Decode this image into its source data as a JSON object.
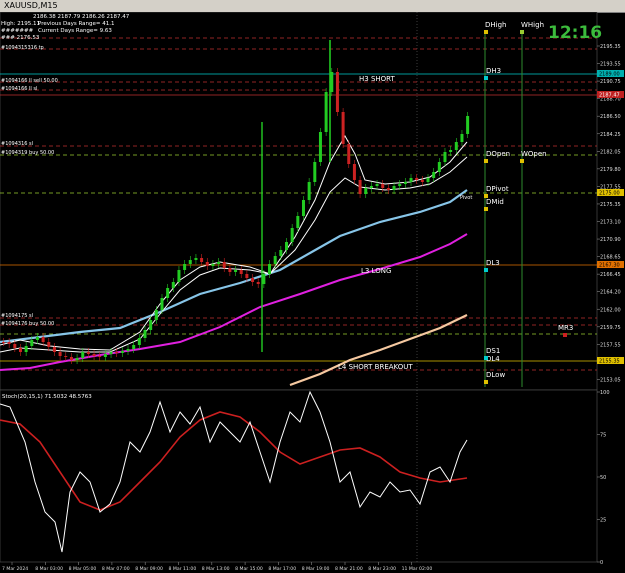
{
  "window": {
    "title": "XAUUSD,M15"
  },
  "info": {
    "ohlc": "2186.38 2187.79 2186.26 2187.47",
    "high_line": "High: 2195.11",
    "prev_range": "Previous Days Range= 41.1",
    "curr_range": "Current Days Range= 9.63",
    "extra1": "#######",
    "extra2": "###  2176.53"
  },
  "clock": {
    "time": "12:16",
    "color": "#3cbb3c"
  },
  "order_labels": {
    "tp": "#1094315316 tp",
    "sell": "#1094166 ll sell 50.00",
    "sell_sl": "#1094166 ll sl",
    "buy_sl": "#1094316 sl",
    "buy": "#1094319 buy 50.00",
    "lower_sl": "#1094175 sl",
    "lower_buy": "#1094176 buy 50.00"
  },
  "levels": {
    "h3_short": "H3 SHORT",
    "l3_long": "L3 LONG",
    "l4_short_breakout": "L4 SHORT BREAKOUT",
    "dhigh": "DHigh",
    "whigh": "WHigh",
    "dh3": "DH3",
    "dopen": "DOpen",
    "wopen": "WOpen",
    "dpivot": "DPivot",
    "dmid": "DMid",
    "dl3": "DL3",
    "mr3": "MR3",
    "ds1": "DS1",
    "dl4": "DL4",
    "dlow": "DLow",
    "pivot": "Pivot"
  },
  "price_axis": {
    "ticks": [
      "2195.35",
      "2193.55",
      "2190.75",
      "2188.70",
      "2186.50",
      "2184.25",
      "2182.05",
      "2179.80",
      "2177.55",
      "2175.35",
      "2173.10",
      "2170.90",
      "2168.65",
      "2166.45",
      "2164.20",
      "2162.00",
      "2159.75",
      "2157.55",
      "2155.30",
      "2153.05"
    ],
    "badges": [
      {
        "text": "2189.00",
        "bg": "#00b0b0",
        "color": "#000"
      },
      {
        "text": "2187.47",
        "bg": "#c02020",
        "color": "#fff"
      },
      {
        "text": "2175.00",
        "bg": "#e0c000",
        "color": "#000"
      },
      {
        "text": "2167.30",
        "bg": "#e07000",
        "color": "#000"
      },
      {
        "text": "2155.35",
        "bg": "#e0c000",
        "color": "#000"
      }
    ]
  },
  "indicator": {
    "label": "Stoch(20,15,1) 71.5032 48.5763",
    "ticks": [
      "100",
      "75",
      "50",
      "25",
      "0"
    ]
  },
  "time_axis": [
    "7 Mar 2024",
    "8 Mar 03:00",
    "8 Mar 05:00",
    "8 Mar 07:00",
    "8 Mar 09:00",
    "8 Mar 11:00",
    "8 Mar 13:00",
    "8 Mar 15:00",
    "8 Mar 17:00",
    "8 Mar 19:00",
    "8 Mar 21:00",
    "8 Mar 23:00",
    "11 Mar 02:00"
  ],
  "colors": {
    "bull": "#22cc22",
    "bear": "#cc2222",
    "ema_fast": "#ffffff",
    "ema_mid": "#b0b0b0",
    "ma_blue": "#87c5e8",
    "ma_magenta": "#e020e0",
    "ma_peach": "#f5c8a0",
    "stoch_main": "#ffffff",
    "stoch_signal": "#cc2020"
  }
}
